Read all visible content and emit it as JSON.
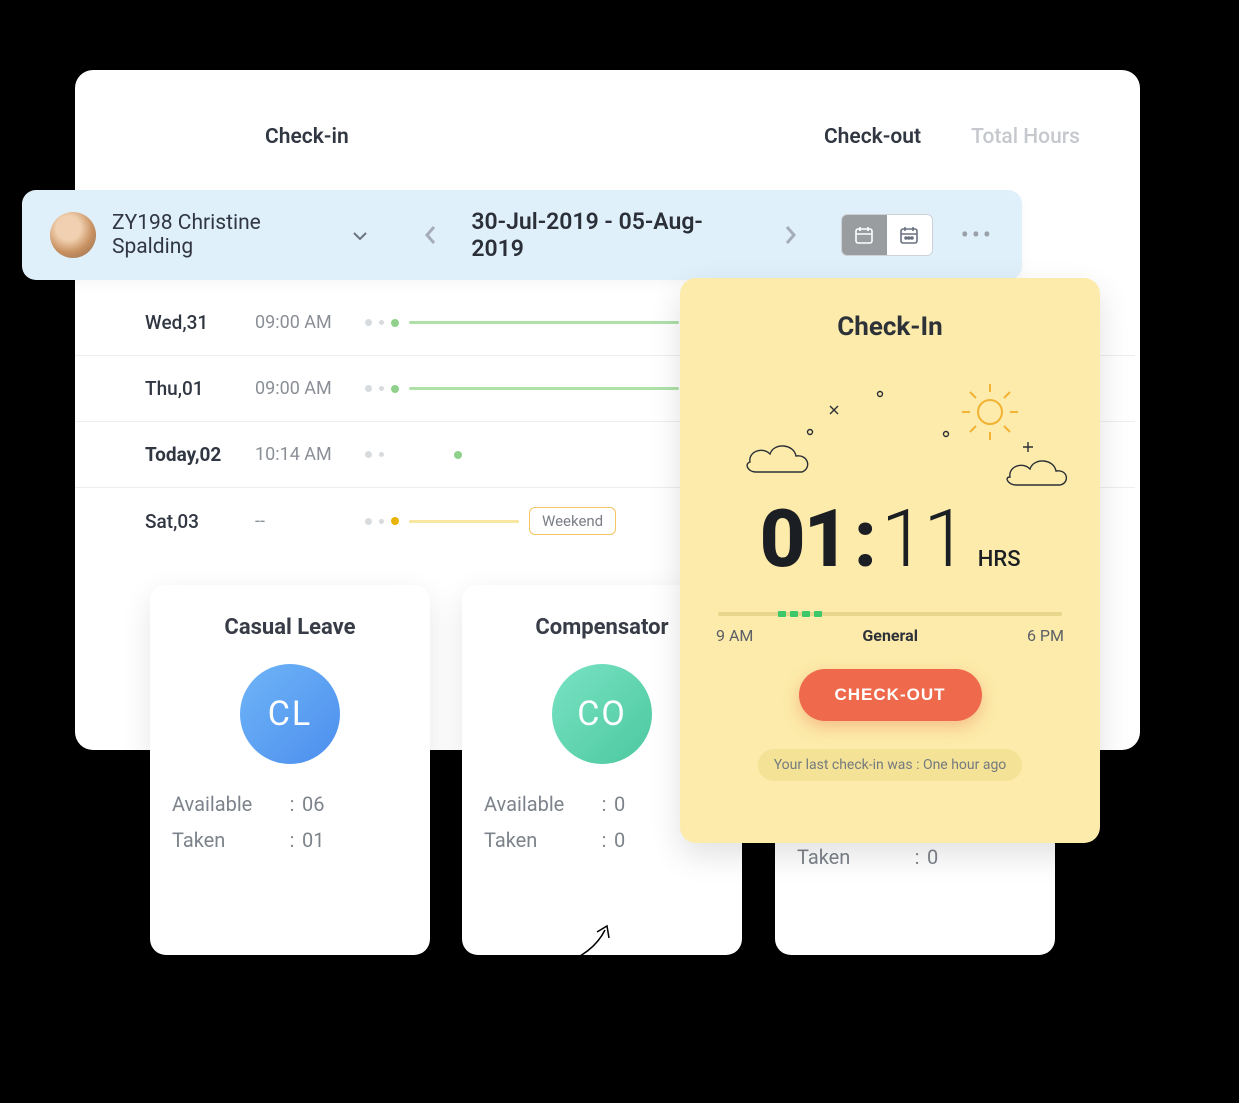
{
  "header": {
    "checkin_label": "Check-in",
    "checkout_label": "Check-out",
    "total_label": "Total Hours"
  },
  "user_bar": {
    "user_name": "ZY198 Christine Spalding",
    "date_range": "30-Jul-2019  -  05-Aug-2019"
  },
  "rows": [
    {
      "day": "Wed,31",
      "time": "09:00 AM",
      "bold": false,
      "line": "long",
      "weekend": false
    },
    {
      "day": "Thu,01",
      "time": "09:00 AM",
      "bold": false,
      "line": "long",
      "weekend": false
    },
    {
      "day": "Today,02",
      "time": "10:14 AM",
      "bold": true,
      "line": "short",
      "weekend": false
    },
    {
      "day": "Sat,03",
      "time": "--",
      "bold": false,
      "line": "weekend",
      "weekend": true
    }
  ],
  "weekend_label": "Weekend",
  "leave_cards": [
    {
      "title": "Casual Leave",
      "badge": "CL",
      "badge_class": "badge-cl",
      "available_label": "Available",
      "available_val": "06",
      "taken_label": "Taken",
      "taken_val": "01"
    },
    {
      "title": "Compensator",
      "badge": "CO",
      "badge_class": "badge-co",
      "available_label": "Available",
      "available_val": "0",
      "taken_label": "Taken",
      "taken_val": "0"
    },
    {
      "title": "",
      "badge": "",
      "badge_class": "",
      "available_label": "",
      "available_val": "",
      "taken_label": "Taken",
      "taken_val": "0"
    }
  ],
  "checkin": {
    "title": "Check-In",
    "hours": "01",
    "mins": "11",
    "hrs_label": "HRS",
    "start_label": "9 AM",
    "end_label": "6 PM",
    "shift_label": "General",
    "button": "CHECK-OUT",
    "last_msg": "Your last check-in was : One hour ago"
  }
}
